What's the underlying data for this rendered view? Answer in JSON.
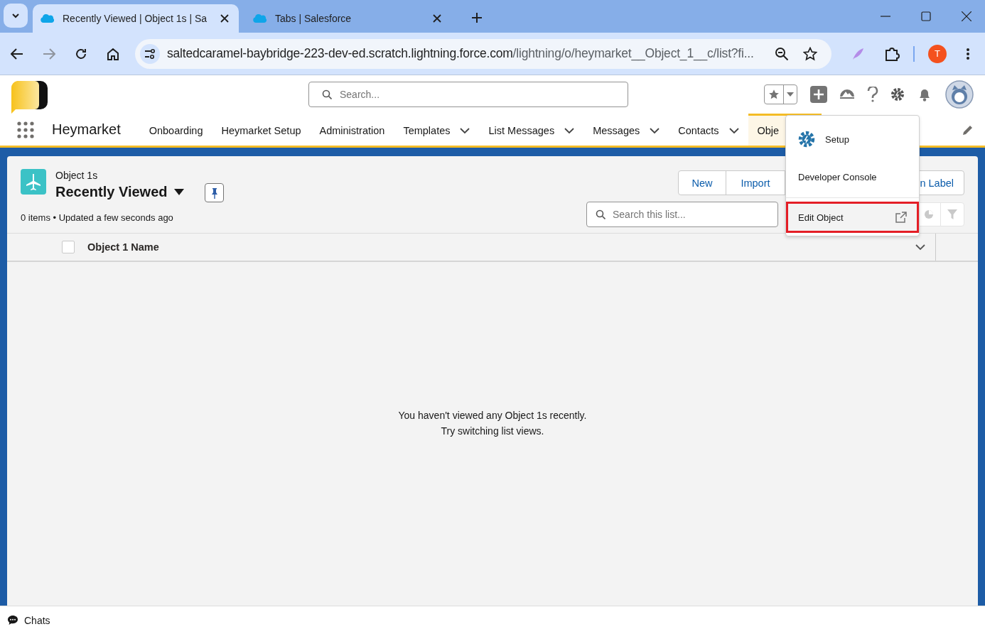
{
  "browser": {
    "tabs": [
      {
        "title": "Recently Viewed | Object 1s | Sa",
        "selected": true
      },
      {
        "title": "Tabs | Salesforce",
        "selected": false
      }
    ],
    "forward_disabled": true,
    "url_host": "saltedcaramel-baybridge-223-dev-ed.scratch.lightning.force.com",
    "url_path": "/lightning/o/heymarket__Object_1__c/list?fi...",
    "profile_initial": "T"
  },
  "header": {
    "search_placeholder": "Search..."
  },
  "nav": {
    "app_name": "Heymarket",
    "items": [
      {
        "label": "Onboarding",
        "dropdown": false,
        "selected": false
      },
      {
        "label": "Heymarket Setup",
        "dropdown": false,
        "selected": false
      },
      {
        "label": "Administration",
        "dropdown": false,
        "selected": false
      },
      {
        "label": "Templates",
        "dropdown": true,
        "selected": false
      },
      {
        "label": "List Messages",
        "dropdown": true,
        "selected": false
      },
      {
        "label": "Messages",
        "dropdown": true,
        "selected": false
      },
      {
        "label": "Contacts",
        "dropdown": true,
        "selected": false
      },
      {
        "label": "Obje",
        "dropdown": false,
        "selected": true
      }
    ]
  },
  "setup_menu": {
    "items": [
      {
        "label": "Setup",
        "kind": "setup",
        "separated": false,
        "highlighted": false
      },
      {
        "label": "Developer Console",
        "kind": "plain",
        "separated": false,
        "highlighted": false
      },
      {
        "label": "Edit Object",
        "kind": "external",
        "separated": true,
        "highlighted": true
      }
    ]
  },
  "list_view": {
    "object_label": "Object 1s",
    "title": "Recently Viewed",
    "status": "0 items • Updated a few seconds ago",
    "buttons": [
      "New",
      "Import",
      "n Label"
    ],
    "search_placeholder": "Search this list...",
    "select_all_checked": false,
    "columns": [
      {
        "label": "Object 1 Name"
      }
    ],
    "empty_lines": [
      "You haven't viewed any Object 1s recently.",
      "Try switching list views."
    ]
  },
  "footer": {
    "label": "Chats"
  }
}
